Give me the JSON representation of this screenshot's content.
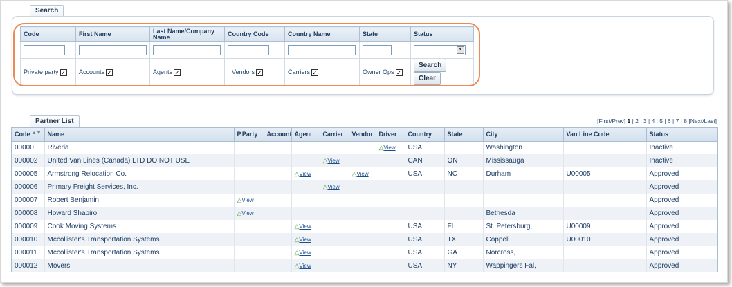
{
  "search": {
    "tab_label": "Search",
    "columns": [
      "Code",
      "First Name",
      "Last Name/Company Name",
      "Country Code",
      "Country Name",
      "State",
      "Status"
    ],
    "inputs": {
      "code": "",
      "first_name": "",
      "last_name": "",
      "country_code": "",
      "country_name": "",
      "state": "",
      "status": ""
    },
    "checkboxes": [
      {
        "label": "Private party",
        "checked": true
      },
      {
        "label": "Accounts",
        "checked": true
      },
      {
        "label": "Agents",
        "checked": true
      },
      {
        "label": "Vendors",
        "checked": true
      },
      {
        "label": "Carriers",
        "checked": true
      },
      {
        "label": "Owner Ops",
        "checked": true
      }
    ],
    "search_button": "Search",
    "clear_button": "Clear",
    "highlight_color": "#ec8a55"
  },
  "partner_list": {
    "tab_label": "Partner List",
    "pagination": {
      "first_prev": "[First/Prev]",
      "pages": [
        "1",
        "2",
        "3",
        "4",
        "5",
        "6",
        "7",
        "8"
      ],
      "current": "1",
      "next_last": "[Next/Last]"
    },
    "columns": [
      "Code",
      "Name",
      "P.Party",
      "Account",
      "Agent",
      "Carrier",
      "Vendor",
      "Driver",
      "Country",
      "State",
      "City",
      "Van Line Code",
      "Status"
    ],
    "view_label": "View",
    "rows": [
      {
        "code": "00000",
        "name": "Riveria",
        "pparty": "",
        "account": "",
        "agent": "",
        "carrier": "",
        "vendor": "",
        "driver": "View",
        "country": "USA",
        "state": "",
        "city": "Washington",
        "vanline": "",
        "status": "Inactive"
      },
      {
        "code": "000002",
        "name": "United Van Lines (Canada) LTD DO NOT USE",
        "pparty": "",
        "account": "",
        "agent": "",
        "carrier": "View",
        "vendor": "",
        "driver": "",
        "country": "CAN",
        "state": "ON",
        "city": "Mississauga",
        "vanline": "",
        "status": "Inactive"
      },
      {
        "code": "000005",
        "name": "Armstrong Relocation Co.",
        "pparty": "",
        "account": "",
        "agent": "View",
        "carrier": "",
        "vendor": "View",
        "driver": "",
        "country": "USA",
        "state": "NC",
        "city": "Durham",
        "vanline": "U00005",
        "status": "Approved"
      },
      {
        "code": "000006",
        "name": "Primary Freight Services, Inc.",
        "pparty": "",
        "account": "",
        "agent": "",
        "carrier": "View",
        "vendor": "",
        "driver": "",
        "country": "",
        "state": "",
        "city": "",
        "vanline": "",
        "status": "Approved"
      },
      {
        "code": "000007",
        "name": "Robert Benjamin",
        "pparty": "View",
        "account": "",
        "agent": "",
        "carrier": "",
        "vendor": "",
        "driver": "",
        "country": "",
        "state": "",
        "city": "",
        "vanline": "",
        "status": "Approved"
      },
      {
        "code": "000008",
        "name": "Howard Shapiro",
        "pparty": "View",
        "account": "",
        "agent": "",
        "carrier": "",
        "vendor": "",
        "driver": "",
        "country": "",
        "state": "",
        "city": "Bethesda",
        "vanline": "",
        "status": "Approved"
      },
      {
        "code": "000009",
        "name": "Cook Moving Systems",
        "pparty": "",
        "account": "",
        "agent": "View",
        "carrier": "",
        "vendor": "",
        "driver": "",
        "country": "USA",
        "state": "FL",
        "city": "St. Petersburg,",
        "vanline": "U00009",
        "status": "Approved"
      },
      {
        "code": "000010",
        "name": "Mccollister's Transportation Systems",
        "pparty": "",
        "account": "",
        "agent": "View",
        "carrier": "",
        "vendor": "",
        "driver": "",
        "country": "USA",
        "state": "TX",
        "city": "Coppell",
        "vanline": "U00010",
        "status": "Approved"
      },
      {
        "code": "000011",
        "name": "Mccollister's Transportation Systems",
        "pparty": "",
        "account": "",
        "agent": "View",
        "carrier": "",
        "vendor": "",
        "driver": "",
        "country": "USA",
        "state": "GA",
        "city": "Norcross,",
        "vanline": "",
        "status": "Approved"
      },
      {
        "code": "000012",
        "name": "Movers",
        "pparty": "",
        "account": "",
        "agent": "View",
        "carrier": "",
        "vendor": "",
        "driver": "",
        "country": "USA",
        "state": "NY",
        "city": "Wappingers Fal,",
        "vanline": "",
        "status": "Approved"
      }
    ]
  }
}
